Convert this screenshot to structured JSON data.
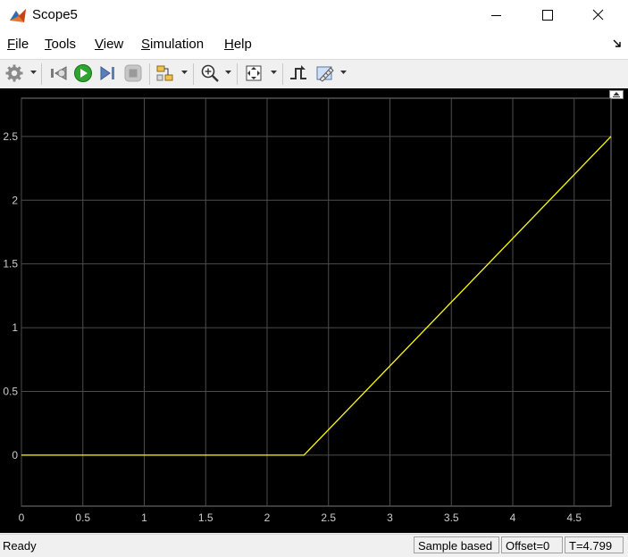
{
  "window": {
    "title": "Scope5",
    "icon": "matlab-scope-icon"
  },
  "menu": {
    "items": [
      "File",
      "Tools",
      "View",
      "Simulation",
      "Help"
    ]
  },
  "toolbar": {
    "buttons": [
      "settings-icon",
      "step-back-icon",
      "run-icon",
      "step-forward-icon",
      "stop-icon",
      "highlight-block-icon",
      "zoom-in-icon",
      "fit-axes-icon",
      "triggers-icon",
      "measurements-icon"
    ]
  },
  "status": {
    "ready": "Ready",
    "mode": "Sample based",
    "offset": "Offset=0",
    "time": "T=4.799"
  },
  "colors": {
    "plot_background": "#000000",
    "grid": "#4d4d4d",
    "signal": "#ffff00",
    "tick_text": "#cccccc"
  },
  "chart_data": {
    "type": "line",
    "title": "",
    "xlabel": "",
    "ylabel": "",
    "xlim": [
      0,
      4.8
    ],
    "ylim": [
      -0.4,
      2.8
    ],
    "xticks": [
      0,
      0.5,
      1,
      1.5,
      2,
      2.5,
      3,
      3.5,
      4,
      4.5
    ],
    "xtick_labels": [
      "0",
      "0.5",
      "1",
      "1.5",
      "2",
      "2.5",
      "3",
      "3.5",
      "4",
      "4.5"
    ],
    "yticks": [
      0,
      0.5,
      1,
      1.5,
      2,
      2.5
    ],
    "ytick_labels": [
      "0",
      "0.5",
      "1",
      "1.5",
      "2",
      "2.5"
    ],
    "grid": true,
    "series": [
      {
        "x": [
          0,
          2.3,
          4.8
        ],
        "y": [
          0,
          0,
          2.5
        ]
      }
    ]
  }
}
